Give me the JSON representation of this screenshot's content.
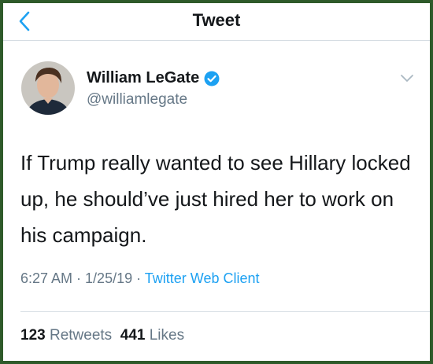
{
  "header": {
    "title": "Tweet",
    "back_icon": "chevron-left-icon"
  },
  "author": {
    "name": "William LeGate",
    "handle": "@williamlegate",
    "verified_icon": "verified-badge-icon",
    "avatar": "avatar"
  },
  "tweet": {
    "text": "If Trump really wanted to see Hillary locked up, he should’ve just hired her to work on his campaign.",
    "time": "6:27 AM",
    "date": "1/25/19",
    "sep": " · ",
    "client": "Twitter Web Client"
  },
  "stats": {
    "retweets_count": "123",
    "retweets_label": "Retweets",
    "likes_count": "441",
    "likes_label": "Likes"
  },
  "colors": {
    "accent": "#1da1f2",
    "text": "#14171a",
    "secondary": "#657786",
    "frame": "#2e5a2a"
  }
}
